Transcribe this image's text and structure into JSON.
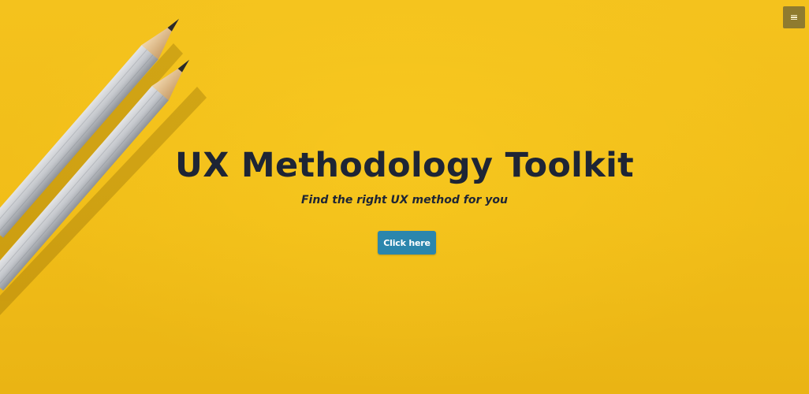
{
  "hero": {
    "title": "UX Methodology Toolkit",
    "subtitle": "Find the right UX method for you",
    "cta_label": "Click here",
    "background_color": "#f2be1a",
    "text_color": "#1e2535",
    "cta_color": "#2b86ad"
  },
  "menu": {
    "icon": "hamburger-menu-icon",
    "color": "#8f7b2f"
  },
  "decoration": {
    "image": "two-pencils-image"
  }
}
